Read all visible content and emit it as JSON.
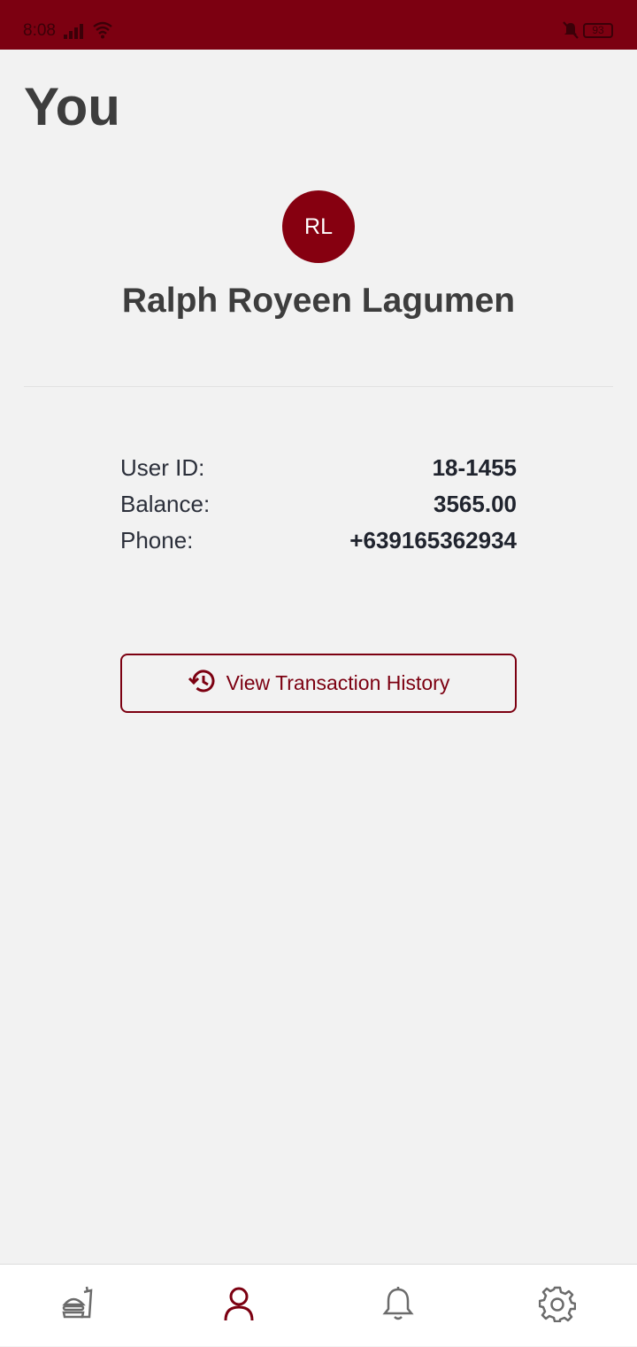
{
  "status_bar": {
    "time": "8:08",
    "battery": "93",
    "icons": [
      "signal-icon",
      "wifi-icon",
      "mute-icon",
      "battery-icon"
    ]
  },
  "page": {
    "title": "You"
  },
  "profile": {
    "initials": "RL",
    "name": "Ralph Royeen Lagumen",
    "avatar_color": "#860010"
  },
  "info": {
    "rows": [
      {
        "label": "User ID:",
        "value": "18-1455"
      },
      {
        "label": "Balance:",
        "value": "3565.00"
      },
      {
        "label": "Phone:",
        "value": "+639165362934"
      }
    ]
  },
  "actions": {
    "history_label": "View Transaction History",
    "history_icon": "history-icon"
  },
  "bottom_nav": {
    "items": [
      {
        "icon": "food-icon",
        "active": false
      },
      {
        "icon": "profile-icon",
        "active": true
      },
      {
        "icon": "bell-icon",
        "active": false
      },
      {
        "icon": "gear-icon",
        "active": false
      }
    ]
  },
  "colors": {
    "brand": "#7c0011",
    "background": "#f2f2f2",
    "text_dark": "#3d3d3d"
  }
}
